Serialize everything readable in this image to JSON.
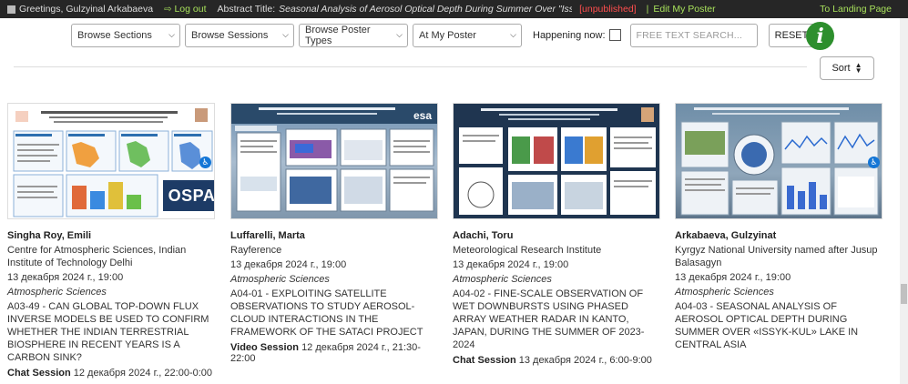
{
  "topbar": {
    "greeting": "Greetings, Gulzyinal Arkabaeva",
    "logout": "Log out",
    "abstract_label": "Abstract Title:",
    "abstract_title": "Seasonal Analysis of Aerosol Optical Depth During Summer Over \"Issyk-Kul\" Lak",
    "status": "[unpublished]",
    "edit": "Edit My Poster",
    "landing": "To Landing Page"
  },
  "filters": {
    "sections": "Browse Sections",
    "sessions": "Browse Sessions",
    "poster_types": "Browse Poster Types",
    "my_poster": "At My Poster",
    "happening_label": "Happening now:",
    "search_placeholder": "FREE TEXT SEARCH...",
    "reset": "RESET",
    "info": "i"
  },
  "sort": {
    "label": "Sort"
  },
  "posters": [
    {
      "author": "Singha Roy, Emili",
      "institution": "Centre for Atmospheric Sciences, Indian Institute of Technology Delhi",
      "date": "13 декабря 2024 г., 19:00",
      "category": "Atmospheric Sciences",
      "title": "A03-49 - Can global top-down flux inverse models be used to confirm whether the Indian terrestrial biosphere in recent years is a carbon sink?",
      "session_type": "Chat Session",
      "session_time": "12 декабря 2024 г., 22:00-0:00",
      "badge": "OSPA"
    },
    {
      "author": "Luffarelli, Marta",
      "institution": "Rayference",
      "date": "13 декабря 2024 г., 19:00",
      "category": "Atmospheric Sciences",
      "title": "A04-01 - Exploiting Satellite Observations to Study Aerosol-Cloud Interactions in the Framework of the SATACI Project",
      "session_type": "Video Session",
      "session_time": "12 декабря 2024 г., 21:30-22:00",
      "logo": "esa"
    },
    {
      "author": "Adachi, Toru",
      "institution": "Meteorological Research Institute",
      "date": "13 декабря 2024 г., 19:00",
      "category": "Atmospheric Sciences",
      "title": "A04-02 - Fine-scale observation of wet downbursts using phased array weather radar in Kanto, Japan, during the summer of 2023-2024",
      "session_type": "Chat Session",
      "session_time": "13 декабря 2024 г., 6:00-9:00"
    },
    {
      "author": "Arkabaeva, Gulzyinat",
      "institution": "Kyrgyz National University named after Jusup Balasagyn",
      "date": "13 декабря 2024 г., 19:00",
      "category": "Atmospheric Sciences",
      "title": "A04-03 - Seasonal Analysis of Aerosol Optical Depth During Summer Over «Issyk-Kul» Lake in Central Asia"
    }
  ],
  "colors": {
    "topbar_bg": "#262626",
    "link_green": "#a7e05b",
    "unpublished_red": "#ff4e4e",
    "info_green": "#2d8f2d",
    "ospa_blue": "#1d3b66"
  }
}
